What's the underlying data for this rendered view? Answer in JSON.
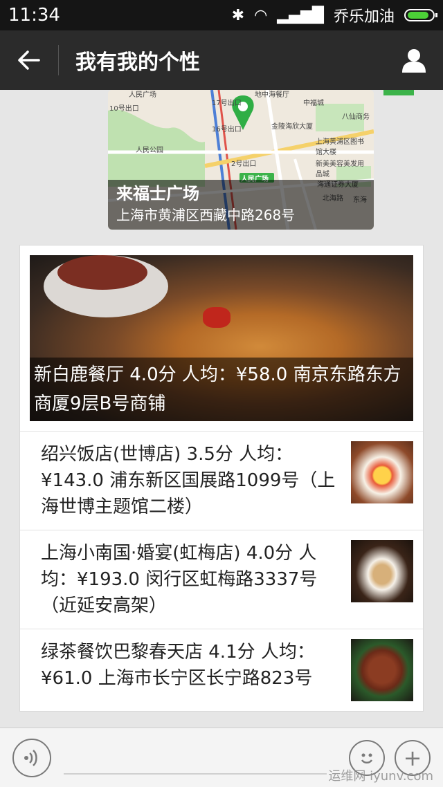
{
  "status_bar": {
    "time": "11:34",
    "carrier": "乔乐加油"
  },
  "header": {
    "title": "我有我的个性"
  },
  "map": {
    "place_name": "来福士广场",
    "address": "上海市黄浦区西藏中路268号",
    "labels": {
      "people_square": "人民广场",
      "people_park": "人民公园",
      "exit_17": "17号出口",
      "exit_16": "16号出口",
      "exit_10": "10号出口",
      "exit_2": "2号出口",
      "exit_11": "11号出口",
      "metro": "人民广场",
      "restaurant": "地中海餐厅",
      "fuzhou": "中福城",
      "babian": "八仙商务",
      "jinling": "金陵海欣大厦",
      "library": "上海黄浦区图书馆大楼",
      "xinmei": "新美美容美发用品城",
      "hantong": "海通证券大厦",
      "beihai": "北海路",
      "dongfeng": "东海"
    }
  },
  "articles": {
    "top": {
      "caption": "新白鹿餐厅 4.0分 人均：¥58.0 南京东路东方商厦9层B号商铺"
    },
    "items": [
      {
        "text": "绍兴饭店(世博店) 3.5分 人均：¥143.0 浦东新区国展路1099号（上海世博主题馆二楼）"
      },
      {
        "text": "上海小南国·婚宴(虹梅店) 4.0分 人均：¥193.0 闵行区虹梅路3337号（近延安高架）"
      },
      {
        "text": "绿茶餐饮巴黎春天店 4.1分 人均：¥61.0 上海市长宁区长宁路823号"
      }
    ]
  },
  "bottom_bar": {
    "watermark": "运维网 iyunv.com"
  },
  "colors": {
    "title_bar": "#2b2b2b",
    "status_bar": "#151515",
    "accent_green": "#3cb34a",
    "map_pin": "#2fae45"
  }
}
